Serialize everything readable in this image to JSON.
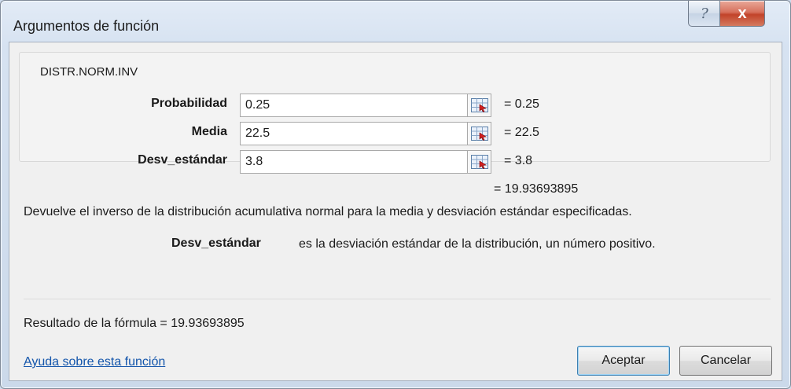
{
  "window": {
    "title": "Argumentos de función",
    "help_glyph": "?",
    "close_glyph": "x"
  },
  "function": {
    "name": "DISTR.NORM.INV"
  },
  "arguments": [
    {
      "label": "Probabilidad",
      "value": "0.25",
      "evaluated": "=  0.25"
    },
    {
      "label": "Media",
      "value": "22.5",
      "evaluated": "=  22.5"
    },
    {
      "label": "Desv_estándar",
      "value": "3.8",
      "evaluated": "=  3.8"
    }
  ],
  "result": {
    "evaluated": "=  19.93693895"
  },
  "description": "Devuelve el inverso de la distribución acumulativa normal para la media y desviación estándar especificadas.",
  "parameter_help": {
    "name": "Desv_estándar",
    "text": "es la desviación estándar de la distribución, un número positivo."
  },
  "formula_result": "Resultado de la fórmula =   19.93693895",
  "help_link": "Ayuda sobre esta función",
  "buttons": {
    "ok": "Aceptar",
    "cancel": "Cancelar"
  },
  "icons": {
    "ref_button": "range-select-icon"
  },
  "colors": {
    "link": "#1355ab",
    "close": "#c2432a"
  }
}
